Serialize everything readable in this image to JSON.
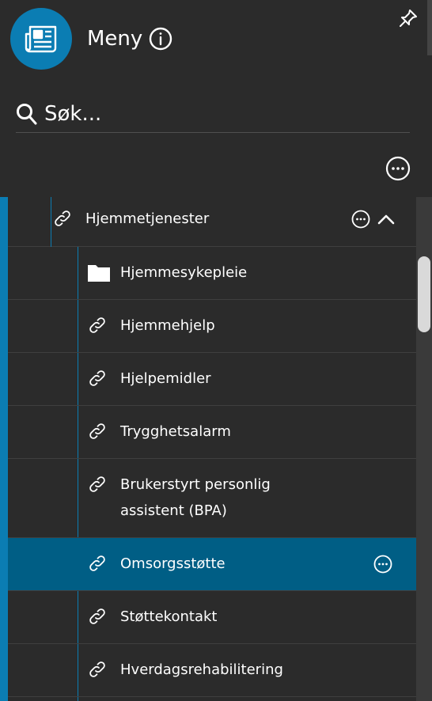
{
  "header": {
    "title": "Meny",
    "search_placeholder": "Søk..."
  },
  "icons": {
    "logo": "newspaper-icon",
    "info": "info-icon",
    "pin": "pin-icon",
    "search": "search-icon",
    "more": "more-horizontal-icon",
    "link": "link-icon",
    "folder": "folder-icon",
    "collapse": "chevron-up-icon"
  },
  "colors": {
    "accent": "#0b7db3",
    "selected": "#005e85",
    "background": "#2b2b2b"
  },
  "tree": {
    "parent": {
      "label": "Hjemmetjenester",
      "expanded": true
    },
    "children": [
      {
        "line1": "Hjemmesykepleie",
        "line2": "",
        "icon": "folder",
        "selected": false
      },
      {
        "line1": "Hjemmehjelp",
        "line2": "",
        "icon": "link",
        "selected": false
      },
      {
        "line1": "Hjelpemidler",
        "line2": "",
        "icon": "link",
        "selected": false
      },
      {
        "line1": "Trygghetsalarm",
        "line2": "",
        "icon": "link",
        "selected": false
      },
      {
        "line1": "Brukerstyrt personlig",
        "line2": "assistent (BPA)",
        "icon": "link",
        "selected": false
      },
      {
        "line1": "Omsorgsstøtte",
        "line2": "",
        "icon": "link",
        "selected": true
      },
      {
        "line1": "Støttekontakt",
        "line2": "",
        "icon": "link",
        "selected": false
      },
      {
        "line1": "Hverdagsrehabilitering",
        "line2": "",
        "icon": "link",
        "selected": false
      }
    ]
  }
}
